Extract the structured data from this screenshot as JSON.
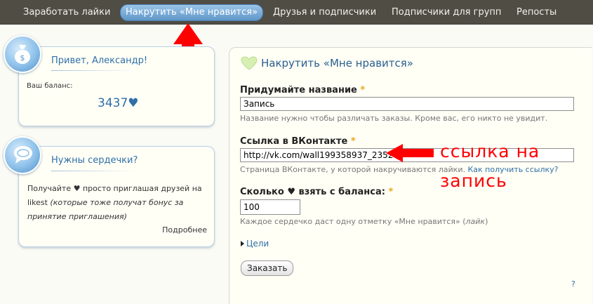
{
  "nav": {
    "items": [
      {
        "label": "Заработать лайки"
      },
      {
        "label": "Накрутить «Мне нравится»"
      },
      {
        "label": "Друзья и подписчики"
      },
      {
        "label": "Подписчики для групп"
      },
      {
        "label": "Репосты"
      }
    ],
    "active_index": 1
  },
  "greeting_card": {
    "title": "Привет, Александр!",
    "balance_label": "Ваш баланс:",
    "balance_value": "3437♥"
  },
  "hearts_card": {
    "title": "Нужны сердечки?",
    "text_main": "Получайте ♥ просто приглашая друзей на likest",
    "text_italic": "(которые тоже получат бонус за принятие приглашения)",
    "more_link": "Подробнее"
  },
  "form": {
    "title": "Накрутить «Мне нравится»",
    "name": {
      "label": "Придумайте название",
      "required_mark": "*",
      "value": "Запись",
      "hint": "Название нужно чтобы различать заказы. Кроме вас, его никто не увидит."
    },
    "link": {
      "label": "Ссылка в ВКонтакте",
      "required_mark": "*",
      "value": "http://vk.com/wall199358937_2352",
      "hint": "Страница ВКонтакте, у которой накручиваются лайки.",
      "hint_link": "Как получить ссылку?"
    },
    "amount": {
      "label": "Сколько ♥ взять с баланса:",
      "required_mark": "*",
      "value": "100",
      "hint_prefix": "Каждое сердечко даст одну отметку «Мне нравится» (",
      "hint_italic": "лайк",
      "hint_suffix": ")"
    },
    "goals_link": "Цели",
    "submit_label": "Заказать",
    "help_mark": "?"
  },
  "annotations": {
    "line1": "ссылка на",
    "line2": "запись",
    "color": "#ff0000"
  },
  "colors": {
    "nav_bg": "#4f4d44",
    "accent_blue": "#2f6fa8",
    "required": "#e9a81b",
    "annotation_red": "#ff0000"
  },
  "icons": {
    "greeting_badge": "money-bag-icon",
    "hearts_badge": "speech-bubble-icon",
    "form_title": "heart-icon",
    "goals": "triangle-right-icon"
  }
}
